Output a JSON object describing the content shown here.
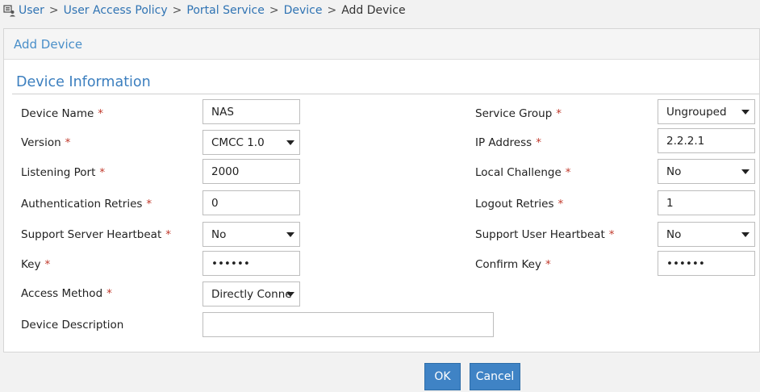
{
  "breadcrumb": {
    "items": [
      "User",
      "User Access Policy",
      "Portal Service",
      "Device"
    ],
    "current": "Add Device",
    "separator": ">"
  },
  "panel": {
    "title": "Add Device"
  },
  "section": {
    "title": "Device Information"
  },
  "form": {
    "device_name": {
      "label": "Device Name",
      "value": "NAS"
    },
    "version": {
      "label": "Version",
      "value": "CMCC 1.0"
    },
    "listening_port": {
      "label": "Listening Port",
      "value": "2000"
    },
    "auth_retries": {
      "label": "Authentication Retries",
      "value": "0"
    },
    "server_heartbeat": {
      "label": "Support Server Heartbeat",
      "value": "No"
    },
    "key": {
      "label": "Key",
      "value": "••••••"
    },
    "access_method": {
      "label": "Access Method",
      "value": "Directly Conne"
    },
    "device_description": {
      "label": "Device Description",
      "value": ""
    },
    "service_group": {
      "label": "Service Group",
      "value": "Ungrouped"
    },
    "ip_address": {
      "label": "IP Address",
      "value": "2.2.2.1"
    },
    "local_challenge": {
      "label": "Local Challenge",
      "value": "No"
    },
    "logout_retries": {
      "label": "Logout Retries",
      "value": "1"
    },
    "user_heartbeat": {
      "label": "Support User Heartbeat",
      "value": "No"
    },
    "confirm_key": {
      "label": "Confirm Key",
      "value": "••••••"
    }
  },
  "required_marker": "*",
  "buttons": {
    "ok": "OK",
    "cancel": "Cancel"
  },
  "colors": {
    "accent": "#3f83c5",
    "link": "#2f73b3",
    "required": "#c0392b"
  }
}
